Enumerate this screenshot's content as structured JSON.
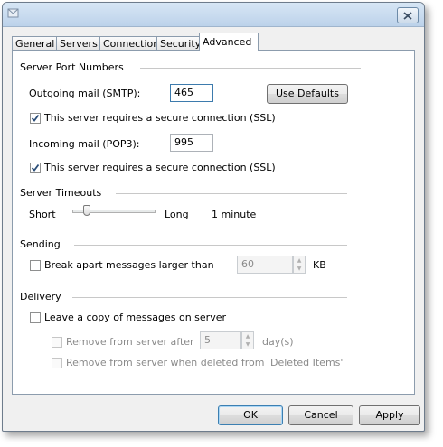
{
  "tabs": [
    {
      "label": "General"
    },
    {
      "label": "Servers"
    },
    {
      "label": "Connection"
    },
    {
      "label": "Security"
    },
    {
      "label": "Advanced",
      "active": true
    }
  ],
  "server_ports": {
    "heading": "Server Port Numbers",
    "outgoing_label": "Outgoing mail (SMTP):",
    "outgoing_value": "465",
    "use_defaults_label": "Use Defaults",
    "smtp_ssl_label": "This server requires a secure connection (SSL)",
    "smtp_ssl_checked": true,
    "incoming_label": "Incoming mail (POP3):",
    "incoming_value": "995",
    "pop_ssl_label": "This server requires a secure connection (SSL)",
    "pop_ssl_checked": true
  },
  "timeouts": {
    "heading": "Server Timeouts",
    "short_label": "Short",
    "long_label": "Long",
    "value_text": "1 minute",
    "slider_level": 0.15
  },
  "sending": {
    "heading": "Sending",
    "break_apart_label": "Break apart messages larger than",
    "break_apart_checked": false,
    "size_value": "60",
    "size_unit": "KB"
  },
  "delivery": {
    "heading": "Delivery",
    "leave_copy_label": "Leave a copy of messages on server",
    "leave_copy_checked": false,
    "remove_after_label": "Remove from server after",
    "remove_after_value": "5",
    "remove_after_unit": "day(s)",
    "remove_deleted_label": "Remove from server when deleted from 'Deleted Items'"
  },
  "buttons": {
    "ok": "OK",
    "cancel": "Cancel",
    "apply": "Apply"
  },
  "colors": {
    "accent": "#3c7fb1",
    "checkmark": "#2a4d78"
  }
}
